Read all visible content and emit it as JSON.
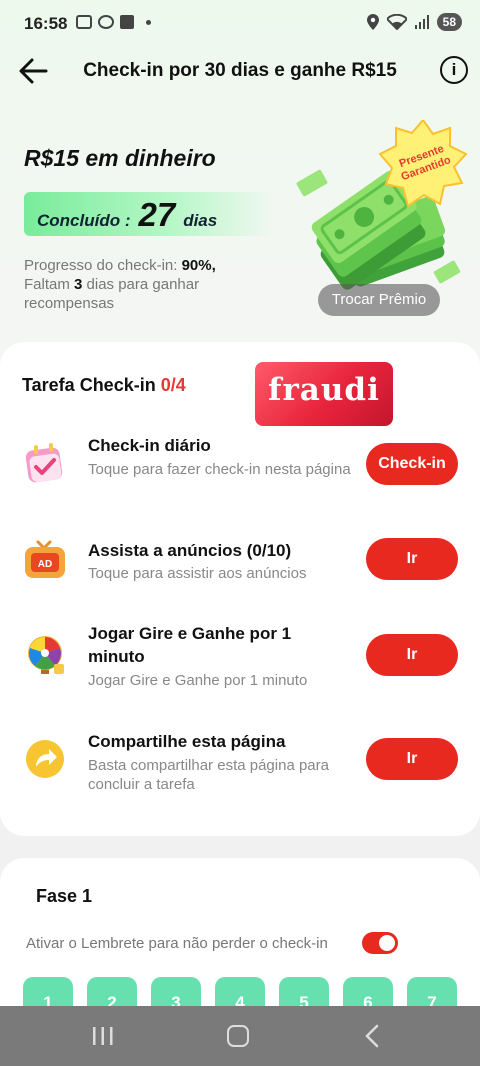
{
  "status_bar": {
    "time": "16:58",
    "battery": "58"
  },
  "header": {
    "title": "Check-in por 30 dias e ganhe R$15"
  },
  "hero": {
    "reward_title": "R$15 em dinheiro",
    "completed_label": "Concluído :",
    "completed_days": "27",
    "completed_unit": "dias",
    "progress_prefix": "Progresso do check-in:",
    "progress_value": "90%,",
    "remaining_prefix": "Faltam",
    "remaining_days": "3",
    "remaining_suffix": "dias para ganhar recompensas",
    "badge_line1": "Presente",
    "badge_line2": "Garantido",
    "swap_label": "Trocar Prêmio"
  },
  "tasks": {
    "heading": "Tarefa Check-in",
    "count": "0/4",
    "logo_text": "fraudi",
    "items": [
      {
        "title": "Check-in diário",
        "subtitle": "Toque para fazer check-in nesta página",
        "button": "Check-in",
        "icon": "calendar-check-icon"
      },
      {
        "title": "Assista a anúncios  (0/10)",
        "subtitle": "Toque para assistir aos anúncios",
        "button": "Ir",
        "icon": "tv-ad-icon"
      },
      {
        "title": "Jogar Gire e Ganhe por 1 minuto",
        "subtitle": "Jogar Gire e Ganhe por 1 minuto",
        "button": "Ir",
        "icon": "spin-wheel-icon"
      },
      {
        "title": "Compartilhe esta página",
        "subtitle": "Basta compartilhar esta página para concluir a tarefa",
        "button": "Ir",
        "icon": "share-arrow-icon"
      }
    ]
  },
  "phase": {
    "title": "Fase 1",
    "reminder_label": "Ativar o Lembrete para não perder o check-in",
    "reminder_on": true,
    "days": [
      "1",
      "2",
      "3",
      "4",
      "5",
      "6",
      "7"
    ]
  },
  "colors": {
    "accent": "#e8291f",
    "completed_green": "#78ec9a",
    "day_cell": "#67e0b0"
  }
}
